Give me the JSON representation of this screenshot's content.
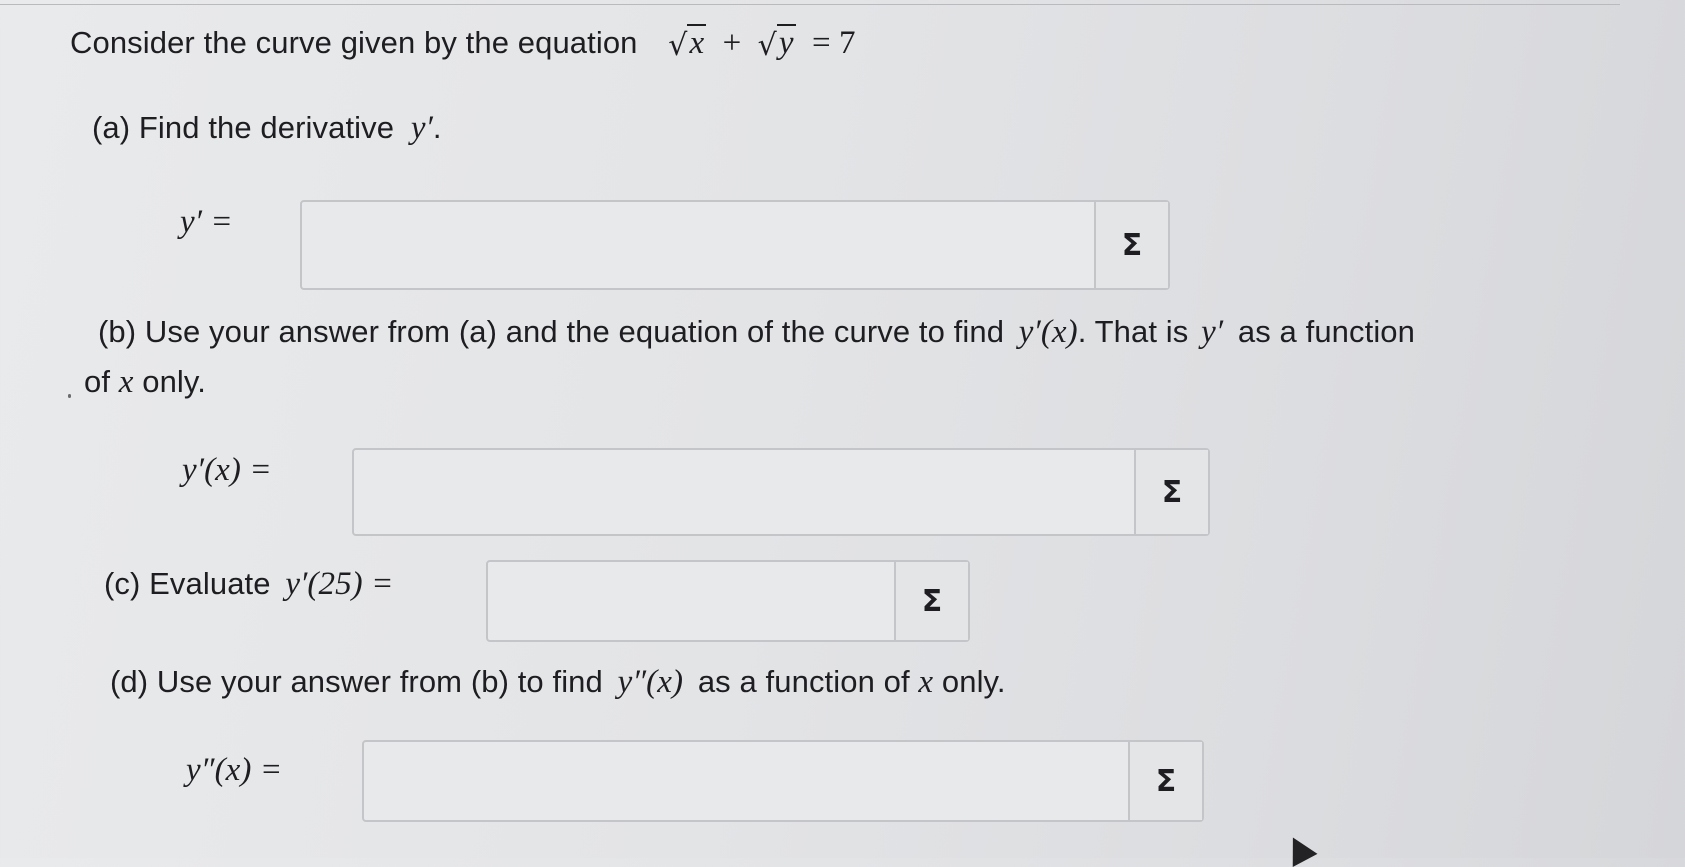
{
  "question": {
    "intro": "Consider the curve given by the equation",
    "equation": {
      "x_var": "x",
      "y_var": "y",
      "plus": "+",
      "equals": "= 7"
    }
  },
  "parts": {
    "a": {
      "text": "(a) Find the derivative",
      "symbol": "y′",
      "end": ".",
      "answer_label": "y′ =",
      "answer_value": "",
      "sigma": "Σ"
    },
    "b": {
      "text1": "(b) Use your answer from (a) and the equation of the curve to find",
      "sym1": "y′(x)",
      "text2": ". That is",
      "sym2": "y′",
      "text3": "as a function",
      "text4": "of",
      "sym3": "x",
      "text5": "only.",
      "answer_label": "y′(x) =",
      "answer_value": "",
      "sigma": "Σ"
    },
    "c": {
      "text": "(c) Evaluate",
      "expr": "y′(25) =",
      "answer_value": "",
      "sigma": "Σ"
    },
    "d": {
      "text1": "(d) Use your answer from (b) to find",
      "sym1": "y″(x)",
      "text2": "as a function of",
      "sym2": "x",
      "text3": "only.",
      "answer_label": "y″(x) =",
      "answer_value": "",
      "sigma": "Σ"
    }
  },
  "colors": {
    "background": "#e3e4e6",
    "text": "#1e1e22",
    "box_border": "#c4c5c8"
  },
  "icons": {
    "sigma_button": "sigma-icon",
    "cursor": "mouse-pointer-icon"
  }
}
